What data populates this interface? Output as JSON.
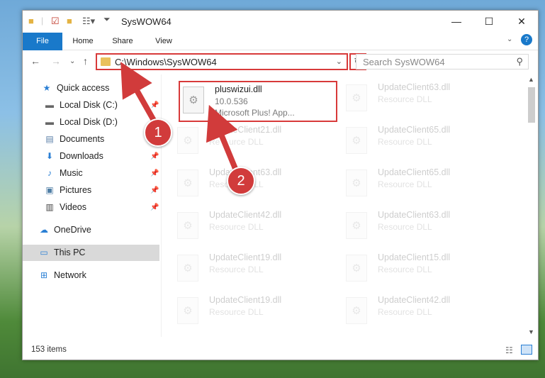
{
  "window": {
    "title": "SysWOW64"
  },
  "ribbon": {
    "tabs": [
      "File",
      "Home",
      "Share",
      "View"
    ]
  },
  "address": {
    "path": "C:\\Windows\\SysWOW64",
    "search_placeholder": "Search SysWOW64"
  },
  "sidebar": {
    "items": [
      {
        "label": "Quick access",
        "icon": "star-icon",
        "pinned": false
      },
      {
        "label": "Local Disk (C:)",
        "icon": "drive-icon",
        "pinned": true
      },
      {
        "label": "Local Disk (D:)",
        "icon": "drive-icon",
        "pinned": false
      },
      {
        "label": "Documents",
        "icon": "documents-icon",
        "pinned": true
      },
      {
        "label": "Downloads",
        "icon": "download-icon",
        "pinned": true
      },
      {
        "label": "Music",
        "icon": "music-icon",
        "pinned": true
      },
      {
        "label": "Pictures",
        "icon": "pictures-icon",
        "pinned": true
      },
      {
        "label": "Videos",
        "icon": "videos-icon",
        "pinned": true
      },
      {
        "label": "OneDrive",
        "icon": "cloud-icon",
        "pinned": false
      },
      {
        "label": "This PC",
        "icon": "pc-icon",
        "pinned": false,
        "selected": true
      },
      {
        "label": "Network",
        "icon": "network-icon",
        "pinned": false
      }
    ]
  },
  "files": [
    {
      "name": "pluswizui.dll",
      "line2": "10.0.536",
      "line3": "Microsoft Plus! App...",
      "highlighted": true
    },
    {
      "name": "UpdateClient63.dll",
      "line2": "Resource DLL"
    },
    {
      "name": "UpdateClient21.dll",
      "line2": "Resource DLL"
    },
    {
      "name": "UpdateClient65.dll",
      "line2": "Resource DLL"
    },
    {
      "name": "UpdateClient63.dll",
      "line2": "Resource DLL"
    },
    {
      "name": "UpdateClient65.dll",
      "line2": "Resource DLL"
    },
    {
      "name": "UpdateClient42.dll",
      "line2": "Resource DLL"
    },
    {
      "name": "UpdateClient63.dll",
      "line2": "Resource DLL"
    },
    {
      "name": "UpdateClient19.dll",
      "line2": "Resource DLL"
    },
    {
      "name": "UpdateClient15.dll",
      "line2": "Resource DLL"
    },
    {
      "name": "UpdateClient19.dll",
      "line2": "Resource DLL"
    },
    {
      "name": "UpdateClient42.dll",
      "line2": "Resource DLL"
    }
  ],
  "status": {
    "item_count": "153 items"
  },
  "annotations": {
    "step1": "1",
    "step2": "2"
  },
  "colors": {
    "accent": "#1979ca",
    "highlight": "#d83a3a"
  }
}
